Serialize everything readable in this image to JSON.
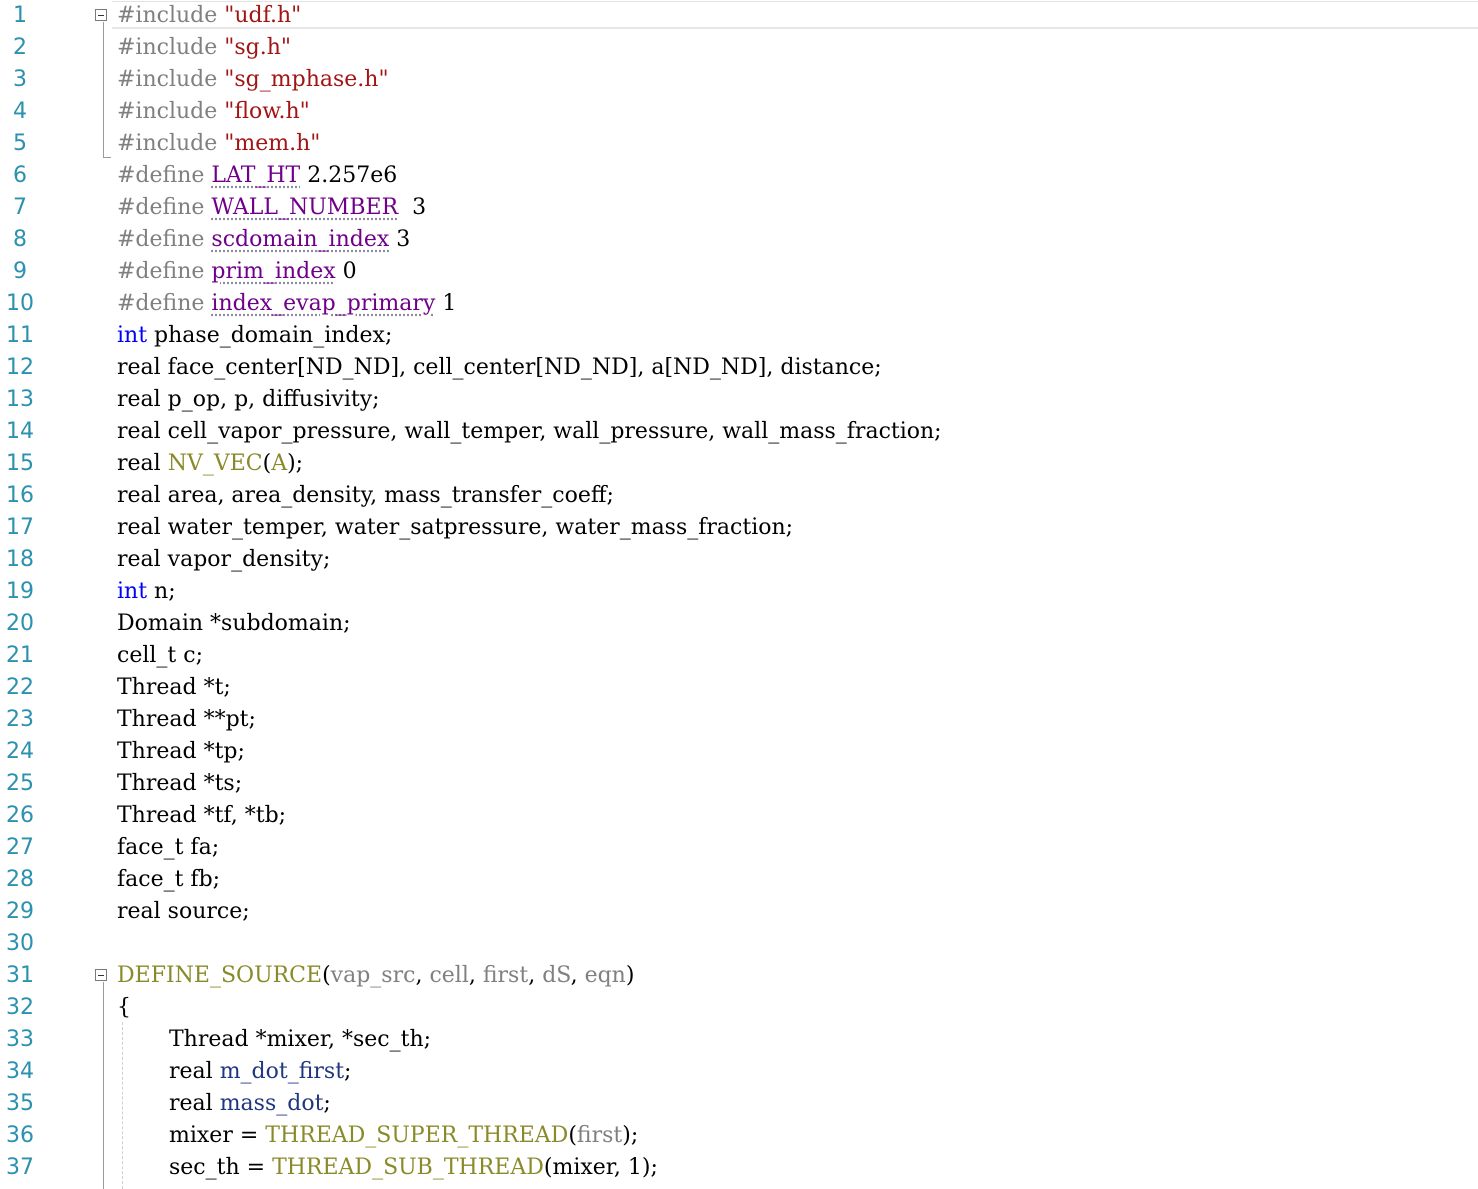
{
  "editor": {
    "lines": [
      {
        "n": "1",
        "tokens": [
          {
            "t": "#include ",
            "c": "pp"
          },
          {
            "t": "\"udf.h\"",
            "c": "str"
          }
        ]
      },
      {
        "n": "2",
        "tokens": [
          {
            "t": "#include ",
            "c": "pp"
          },
          {
            "t": "\"sg.h\"",
            "c": "str"
          }
        ]
      },
      {
        "n": "3",
        "tokens": [
          {
            "t": "#include ",
            "c": "pp"
          },
          {
            "t": "\"sg_mphase.h\"",
            "c": "str"
          }
        ]
      },
      {
        "n": "4",
        "tokens": [
          {
            "t": "#include ",
            "c": "pp"
          },
          {
            "t": "\"flow.h\"",
            "c": "str"
          }
        ]
      },
      {
        "n": "5",
        "tokens": [
          {
            "t": "#include ",
            "c": "pp"
          },
          {
            "t": "\"mem.h\"",
            "c": "str"
          }
        ]
      },
      {
        "n": "6",
        "tokens": [
          {
            "t": "#define ",
            "c": "pp"
          },
          {
            "t": "LAT_HT",
            "c": "mac",
            "sq": true
          },
          {
            "t": " 2.257e6",
            "c": "plain"
          }
        ]
      },
      {
        "n": "7",
        "tokens": [
          {
            "t": "#define ",
            "c": "pp"
          },
          {
            "t": "WALL_NUMBER",
            "c": "mac",
            "sq": true
          },
          {
            "t": "  3",
            "c": "plain"
          }
        ]
      },
      {
        "n": "8",
        "tokens": [
          {
            "t": "#define ",
            "c": "pp"
          },
          {
            "t": "scdomain_index",
            "c": "mac",
            "sq": true
          },
          {
            "t": " 3",
            "c": "plain"
          }
        ]
      },
      {
        "n": "9",
        "tokens": [
          {
            "t": "#define ",
            "c": "pp"
          },
          {
            "t": "prim_index",
            "c": "mac",
            "sq": true
          },
          {
            "t": " 0",
            "c": "plain"
          }
        ]
      },
      {
        "n": "10",
        "tokens": [
          {
            "t": "#define ",
            "c": "pp"
          },
          {
            "t": "index_evap_primary",
            "c": "mac",
            "sq": true
          },
          {
            "t": " 1",
            "c": "plain"
          }
        ]
      },
      {
        "n": "11",
        "tokens": [
          {
            "t": "int",
            "c": "kw"
          },
          {
            "t": " phase_domain_index;",
            "c": "plain"
          }
        ]
      },
      {
        "n": "12",
        "tokens": [
          {
            "t": "real face_center[ND_ND], cell_center[ND_ND], a[ND_ND], distance;",
            "c": "plain"
          }
        ]
      },
      {
        "n": "13",
        "tokens": [
          {
            "t": "real p_op, p, diffusivity;",
            "c": "plain"
          }
        ]
      },
      {
        "n": "14",
        "tokens": [
          {
            "t": "real cell_vapor_pressure, wall_temper, wall_pressure, wall_mass_fraction;",
            "c": "plain"
          }
        ]
      },
      {
        "n": "15",
        "tokens": [
          {
            "t": "real ",
            "c": "plain"
          },
          {
            "t": "NV_VEC",
            "c": "macro-fn"
          },
          {
            "t": "(",
            "c": "plain"
          },
          {
            "t": "A",
            "c": "macro-fn"
          },
          {
            "t": ");",
            "c": "plain"
          }
        ]
      },
      {
        "n": "16",
        "tokens": [
          {
            "t": "real area, area_density, mass_transfer_coeff;",
            "c": "plain"
          }
        ]
      },
      {
        "n": "17",
        "tokens": [
          {
            "t": "real water_temper, water_satpressure, water_mass_fraction;",
            "c": "plain"
          }
        ]
      },
      {
        "n": "18",
        "tokens": [
          {
            "t": "real vapor_density;",
            "c": "plain"
          }
        ]
      },
      {
        "n": "19",
        "tokens": [
          {
            "t": "int",
            "c": "kw"
          },
          {
            "t": " n;",
            "c": "plain"
          }
        ]
      },
      {
        "n": "20",
        "tokens": [
          {
            "t": "Domain *subdomain;",
            "c": "plain"
          }
        ]
      },
      {
        "n": "21",
        "tokens": [
          {
            "t": "cell_t c;",
            "c": "plain"
          }
        ]
      },
      {
        "n": "22",
        "tokens": [
          {
            "t": "Thread *t;",
            "c": "plain"
          }
        ]
      },
      {
        "n": "23",
        "tokens": [
          {
            "t": "Thread **pt;",
            "c": "plain"
          }
        ]
      },
      {
        "n": "24",
        "tokens": [
          {
            "t": "Thread *tp;",
            "c": "plain"
          }
        ]
      },
      {
        "n": "25",
        "tokens": [
          {
            "t": "Thread *ts;",
            "c": "plain"
          }
        ]
      },
      {
        "n": "26",
        "tokens": [
          {
            "t": "Thread *tf, *tb;",
            "c": "plain"
          }
        ]
      },
      {
        "n": "27",
        "tokens": [
          {
            "t": "face_t fa;",
            "c": "plain"
          }
        ]
      },
      {
        "n": "28",
        "tokens": [
          {
            "t": "face_t fb;",
            "c": "plain"
          }
        ]
      },
      {
        "n": "29",
        "tokens": [
          {
            "t": "real source;",
            "c": "plain"
          }
        ]
      },
      {
        "n": "30",
        "tokens": []
      },
      {
        "n": "31",
        "tokens": [
          {
            "t": "DEFINE_SOURCE",
            "c": "macro-fn"
          },
          {
            "t": "(",
            "c": "plain"
          },
          {
            "t": "vap_src",
            "c": "param"
          },
          {
            "t": ", ",
            "c": "plain"
          },
          {
            "t": "cell",
            "c": "param"
          },
          {
            "t": ", ",
            "c": "plain"
          },
          {
            "t": "first",
            "c": "param"
          },
          {
            "t": ", ",
            "c": "plain"
          },
          {
            "t": "dS",
            "c": "param"
          },
          {
            "t": ", ",
            "c": "plain"
          },
          {
            "t": "eqn",
            "c": "param"
          },
          {
            "t": ")",
            "c": "plain"
          }
        ]
      },
      {
        "n": "32",
        "tokens": [
          {
            "t": "{",
            "c": "plain"
          }
        ]
      },
      {
        "n": "33",
        "indent": true,
        "tokens": [
          {
            "t": "Thread *mixer, *sec_th;",
            "c": "plain"
          }
        ]
      },
      {
        "n": "34",
        "indent": true,
        "tokens": [
          {
            "t": "real ",
            "c": "plain"
          },
          {
            "t": "m_dot_first",
            "c": "local"
          },
          {
            "t": ";",
            "c": "plain"
          }
        ]
      },
      {
        "n": "35",
        "indent": true,
        "tokens": [
          {
            "t": "real ",
            "c": "plain"
          },
          {
            "t": "mass_dot",
            "c": "local"
          },
          {
            "t": ";",
            "c": "plain"
          }
        ]
      },
      {
        "n": "36",
        "indent": true,
        "tokens": [
          {
            "t": "mixer = ",
            "c": "plain"
          },
          {
            "t": "THREAD_SUPER_THREAD",
            "c": "macro-fn"
          },
          {
            "t": "(",
            "c": "plain"
          },
          {
            "t": "first",
            "c": "param"
          },
          {
            "t": ");",
            "c": "plain"
          }
        ]
      },
      {
        "n": "37",
        "indent": true,
        "tokens": [
          {
            "t": "sec_th = ",
            "c": "plain"
          },
          {
            "t": "THREAD_SUB_THREAD",
            "c": "macro-fn"
          },
          {
            "t": "(mixer, 1);",
            "c": "plain"
          }
        ]
      }
    ]
  }
}
